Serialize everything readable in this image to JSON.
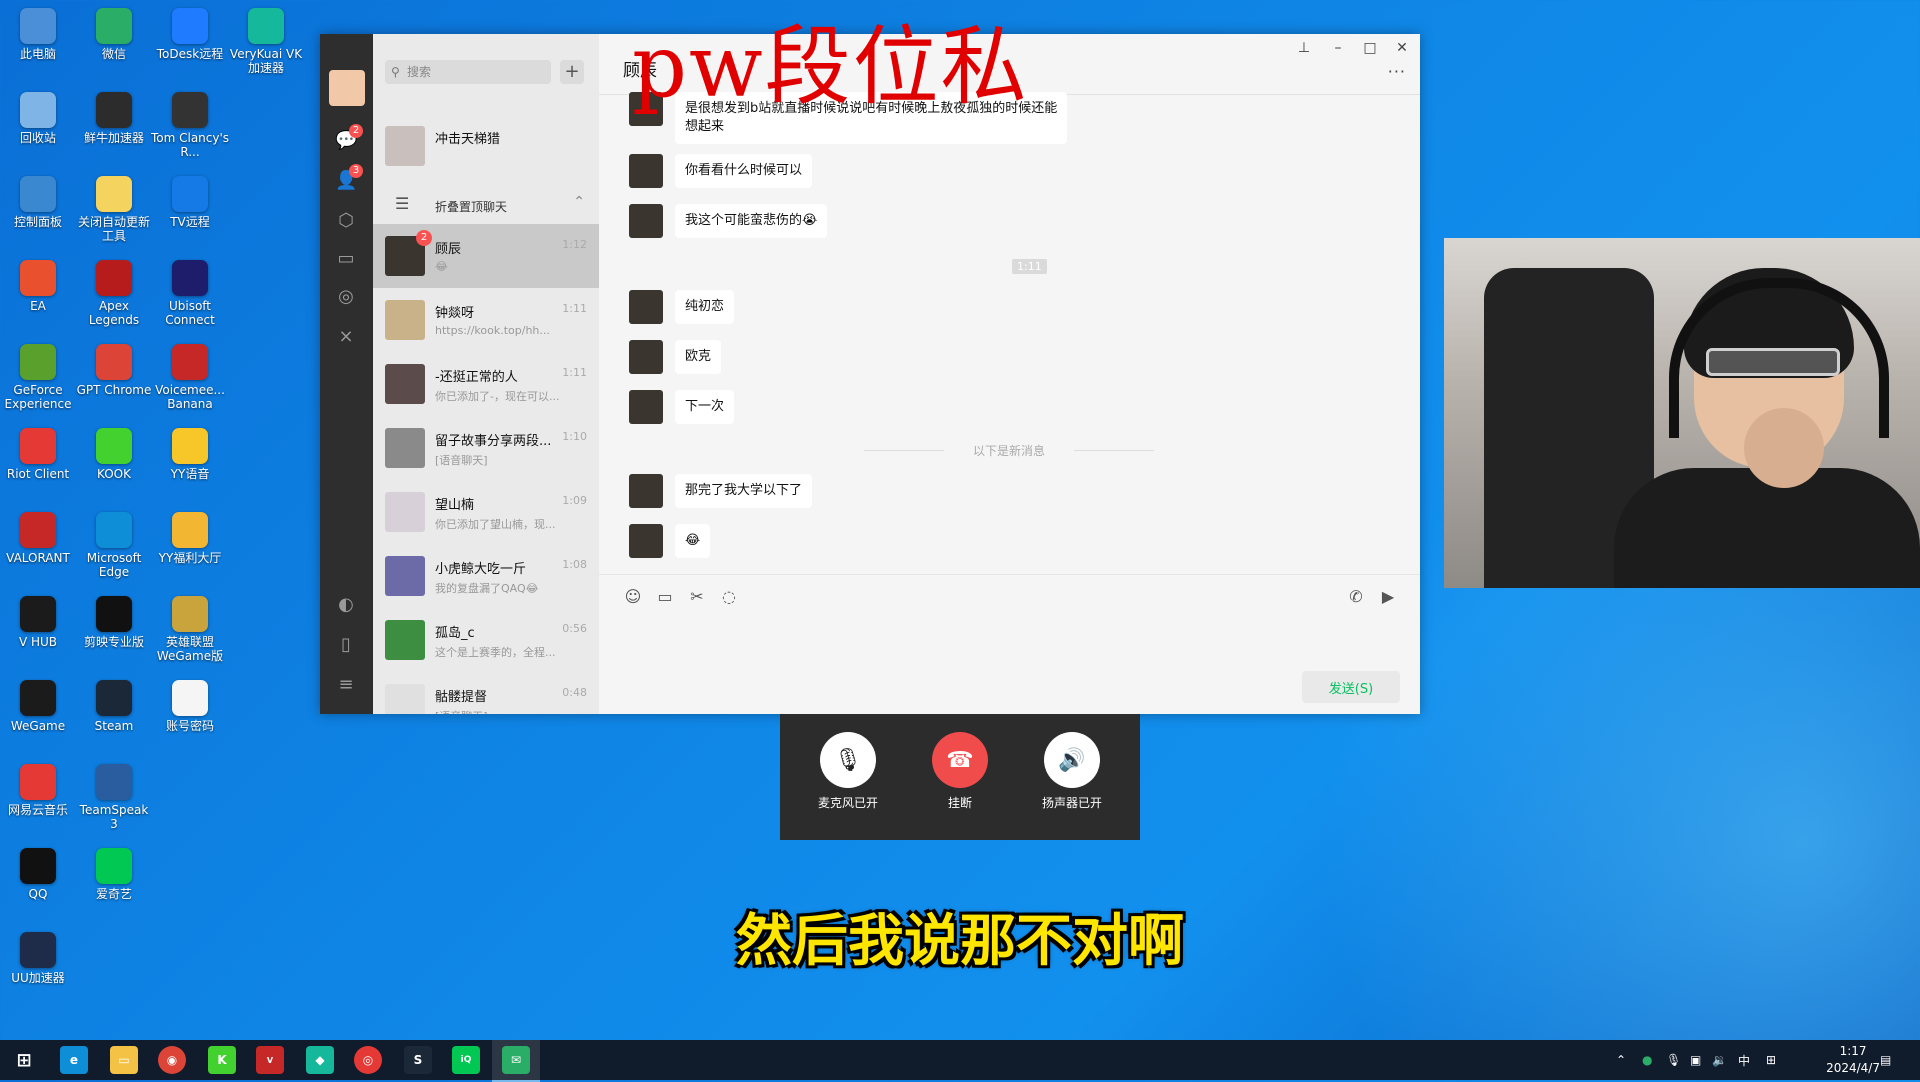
{
  "desktop": {
    "icons": [
      {
        "label": "此电脑",
        "color": "#4a8fd8"
      },
      {
        "label": "微信",
        "color": "#2aae67"
      },
      {
        "label": "ToDesk远程",
        "color": "#1f7bff"
      },
      {
        "label": "VeryKuai VK加速器",
        "color": "#15b89a"
      },
      {
        "label": "回收站",
        "color": "#7fb5e6"
      },
      {
        "label": "鲜牛加速器",
        "color": "#2c2c2c"
      },
      {
        "label": "Tom Clancy's R...",
        "color": "#333333"
      },
      {
        "label": "控制面板",
        "color": "#3a88d0"
      },
      {
        "label": "关闭自动更新工具",
        "color": "#f4d35e"
      },
      {
        "label": "TV远程",
        "color": "#1579e6"
      },
      {
        "label": "EA",
        "color": "#e8502e"
      },
      {
        "label": "Apex Legends",
        "color": "#b71c1c"
      },
      {
        "label": "Ubisoft Connect",
        "color": "#1d1d6b"
      },
      {
        "label": "GeForce Experience",
        "color": "#5aa02c"
      },
      {
        "label": "GPT Chrome",
        "color": "#db4437"
      },
      {
        "label": "Voicemee... Banana",
        "color": "#c62828"
      },
      {
        "label": "Riot Client",
        "color": "#e53935"
      },
      {
        "label": "KOOK",
        "color": "#43d12f"
      },
      {
        "label": "YY语音",
        "color": "#f7c629"
      },
      {
        "label": "VALORANT",
        "color": "#c62828"
      },
      {
        "label": "Microsoft Edge",
        "color": "#0f8ed8"
      },
      {
        "label": "YY福利大厅",
        "color": "#f2b632"
      },
      {
        "label": "V HUB",
        "color": "#1b1b1b"
      },
      {
        "label": "剪映专业版",
        "color": "#111111"
      },
      {
        "label": "英雄联盟WeGame版",
        "color": "#c9a43c"
      },
      {
        "label": "WeGame",
        "color": "#1b1b1b"
      },
      {
        "label": "Steam",
        "color": "#1b2838"
      },
      {
        "label": "账号密码",
        "color": "#f5f5f5"
      },
      {
        "label": "网易云音乐",
        "color": "#e53935"
      },
      {
        "label": "TeamSpeak 3",
        "color": "#2a5d9f"
      },
      {
        "label": "QQ",
        "color": "#111111"
      },
      {
        "label": "爱奇艺",
        "color": "#00c853"
      },
      {
        "label": "UU加速器",
        "color": "#1e2b49"
      }
    ]
  },
  "wechat": {
    "rail": {
      "chat_badge": "2",
      "contacts_badge": "3"
    },
    "search": {
      "placeholder": "搜索",
      "add": "+"
    },
    "conversations_top": [
      {
        "name": "冲击天梯猎",
        "preview": "",
        "time": ""
      }
    ],
    "folded_label": "折叠置顶聊天",
    "conversations": [
      {
        "name": "顾辰",
        "preview": "😂",
        "time": "1:12",
        "badge": "2",
        "avatar": "#3b3530",
        "selected": true
      },
      {
        "name": "钟燚呀",
        "preview": "https://kook.top/hh...",
        "time": "1:11",
        "badge": "",
        "avatar": "#c9b28a"
      },
      {
        "name": "-还挺正常的人",
        "preview": "你已添加了-，现在可以...",
        "time": "1:11",
        "badge": "",
        "avatar": "#5b4b4b"
      },
      {
        "name": "留子故事分享两段...",
        "preview": "[语音聊天]",
        "time": "1:10",
        "badge": "",
        "avatar": "#8a8a8a"
      },
      {
        "name": "望山楠",
        "preview": "你已添加了望山楠，现...",
        "time": "1:09",
        "badge": "",
        "avatar": "#d8d0d8"
      },
      {
        "name": "小虎鲸大吃一斤",
        "preview": "我的复盘漏了QAQ😂",
        "time": "1:08",
        "badge": "",
        "avatar": "#6d6aa8"
      },
      {
        "name": "孤岛_c",
        "preview": "这个是上赛季的，全程...",
        "time": "0:56",
        "badge": "",
        "avatar": "#3e8e41"
      },
      {
        "name": "骷髅提督",
        "preview": "[语音聊天]",
        "time": "0:48",
        "badge": "",
        "avatar": "#e0e0e0"
      }
    ],
    "chat": {
      "title": "顾辰",
      "more": "···",
      "messages": [
        {
          "text": "是很想发到b站就直播时候说说吧有时候晚上敖夜孤独的时候还能想起来",
          "multiline": true
        },
        {
          "text": "你看看什么时候可以"
        },
        {
          "text": "我这个可能蛮悲伤的😭"
        },
        {
          "text": "纯初恋"
        },
        {
          "text": "欧克"
        },
        {
          "text": "下一次"
        },
        {
          "text": "那完了我大学以下了"
        },
        {
          "text": "😂"
        }
      ],
      "message_line2": "想起来",
      "message_line1": "是很想发到b站就直播时候说说吧有时候晚上敖夜孤独的时候还能",
      "time_chip": "1:11",
      "new_divider": "以下是新消息",
      "send_label": "发送(S)"
    }
  },
  "call": {
    "mic_label": "麦克风已开",
    "hangup_label": "挂断",
    "speaker_label": "扬声器已开"
  },
  "overlay": {
    "watermark": "pw段位私",
    "subtitle": "然后我说那不对啊"
  },
  "taskbar": {
    "ime": "中",
    "time": "1:17",
    "date": "2024/4/7"
  }
}
